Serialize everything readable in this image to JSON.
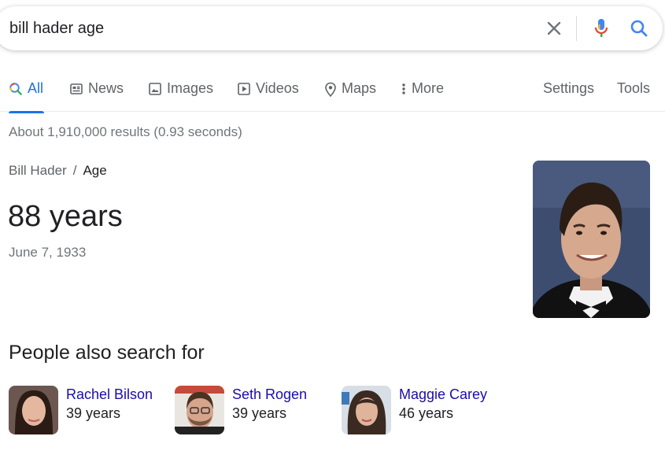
{
  "search": {
    "query": "bill hader age",
    "clear_icon": "close-icon",
    "mic_icon": "microphone-icon",
    "search_icon": "search-icon"
  },
  "tabs": [
    {
      "label": "All",
      "icon": "search-icon",
      "active": true
    },
    {
      "label": "News",
      "icon": "news-icon"
    },
    {
      "label": "Images",
      "icon": "image-icon"
    },
    {
      "label": "Videos",
      "icon": "video-icon"
    },
    {
      "label": "Maps",
      "icon": "map-pin-icon"
    },
    {
      "label": "More",
      "icon": "more-vert-icon"
    }
  ],
  "tools": {
    "settings": "Settings",
    "tools": "Tools"
  },
  "result_stats": "About 1,910,000 results (0.93 seconds)",
  "answer": {
    "breadcrumb_entity": "Bill Hader",
    "breadcrumb_separator": "/",
    "breadcrumb_attribute": "Age",
    "value": "88 years",
    "subtext": "June 7, 1933"
  },
  "people_also_search": {
    "title": "People also search for",
    "people": [
      {
        "name": "Rachel Bilson",
        "age": "39 years"
      },
      {
        "name": "Seth Rogen",
        "age": "39 years"
      },
      {
        "name": "Maggie Carey",
        "age": "46 years"
      }
    ]
  },
  "colors": {
    "accent_blue": "#1a73e8",
    "link": "#1a0dab",
    "secondary_text": "#70757a"
  }
}
